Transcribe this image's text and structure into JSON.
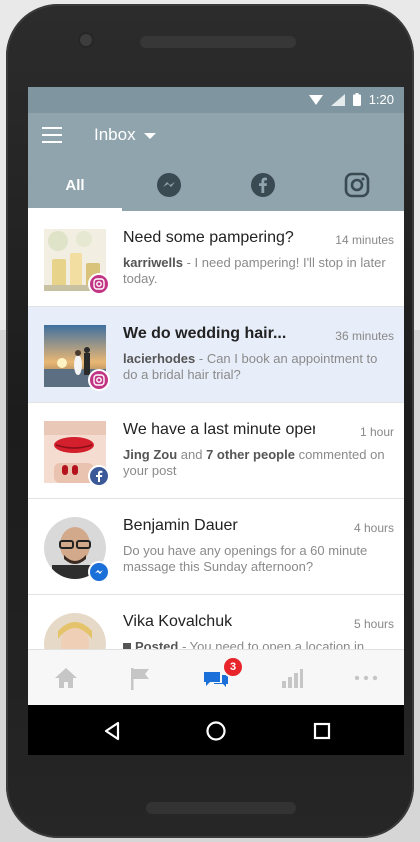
{
  "status_bar": {
    "time": "1:20"
  },
  "header": {
    "title": "Inbox"
  },
  "tabs": [
    {
      "label": "All",
      "icon": "none"
    },
    {
      "label": "",
      "icon": "messenger-icon"
    },
    {
      "label": "",
      "icon": "facebook-icon"
    },
    {
      "label": "",
      "icon": "instagram-icon"
    }
  ],
  "messages": [
    {
      "title": "Need some pampering?",
      "time": "14 minutes",
      "sender": "karriwells",
      "text": " - I need pampering! I'll stop in later today.",
      "source": "instagram"
    },
    {
      "title": "We do wedding hair...",
      "time": "36 minutes",
      "sender": "lacierhodes",
      "text": " - Can I book an appointment to do a bridal hair trial?",
      "source": "instagram"
    },
    {
      "title": "We have a last minute open...",
      "time": "1 hour",
      "sender": "Jing Zou",
      "text_mid": " and ",
      "sender2": "7 other people",
      "text": " commented on your post",
      "source": "facebook"
    },
    {
      "title": "Benjamin Dauer",
      "time": "4 hours",
      "text": "Do you have any openings for a 60 minute massage this Sunday afternoon?",
      "source": "messenger"
    },
    {
      "title": "Vika Kovalchuk",
      "time": "5 hours",
      "sender": "Posted",
      "text": " - You need to open a location in",
      "source": "messenger"
    }
  ],
  "bottom_nav": {
    "badge_count": "3"
  },
  "colors": {
    "header": "#8fa4ad",
    "status": "#7f96a0",
    "accent": "#1a6fd8",
    "badge": "#e8252a"
  }
}
